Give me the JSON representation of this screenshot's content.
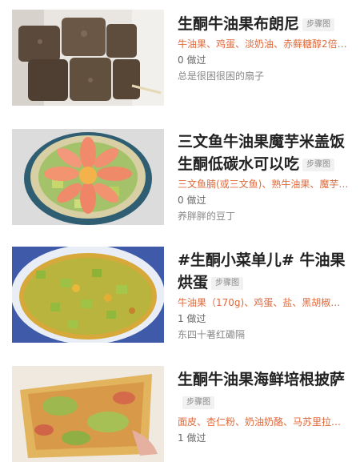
{
  "recipes": [
    {
      "title": "生酮牛油果布朗尼",
      "badge": "步骤图",
      "ingredients": "牛油果、鸡蛋、淡奶油、赤藓糖醇2倍…",
      "made_count": "0 做过",
      "author": "总是很困很困的扇子",
      "thumb_icon": "brownie-photo"
    },
    {
      "title": "三文鱼牛油果魔芋米盖饭生酮低碳水可以吃",
      "badge": "步骤图",
      "ingredients": "三文鱼腩(或三文鱼)、熟牛油果、魔芋…",
      "made_count": "0 做过",
      "author": "养胖胖的豆丁",
      "thumb_icon": "salmon-bowl-photo"
    },
    {
      "title": "#生酮小菜单儿# 牛油果烘蛋",
      "badge": "步骤图",
      "ingredients": "牛油果（170g)、鸡蛋、盐、黑胡椒…",
      "made_count": "1 做过",
      "author": "东四十著红磡隔",
      "thumb_icon": "avocado-frittata-photo"
    },
    {
      "title": "生酮牛油果海鲜培根披萨",
      "badge": "步骤图",
      "ingredients": "面皮、杏仁粉、奶油奶酪、马苏里拉…",
      "made_count": "1 做过",
      "author": "",
      "thumb_icon": "pizza-photo"
    }
  ]
}
